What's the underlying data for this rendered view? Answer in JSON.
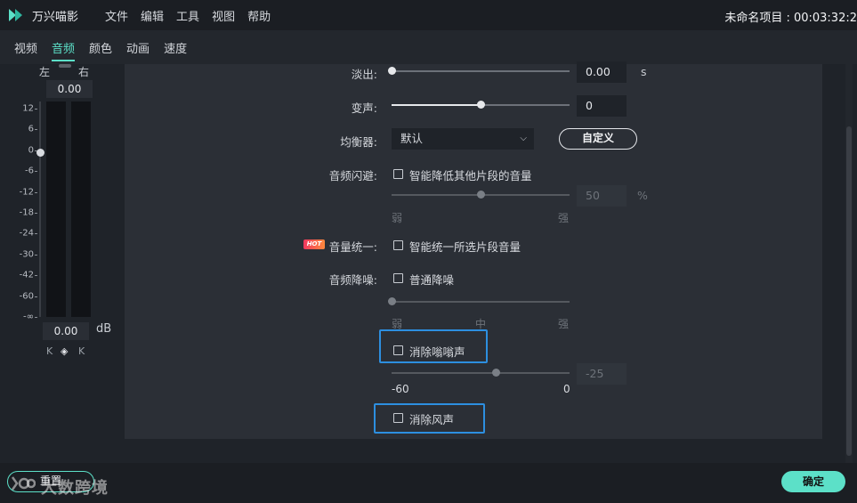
{
  "app": {
    "name": "万兴喵影",
    "project": "未命名项目 : 00:03:32:2"
  },
  "menu": [
    "文件",
    "编辑",
    "工具",
    "视图",
    "帮助"
  ],
  "tabs": [
    "视频",
    "音频",
    "颜色",
    "动画",
    "速度"
  ],
  "active_tab": 1,
  "meter": {
    "left": "左",
    "right": "右",
    "balance": "0.00",
    "ticks": [
      "12",
      "6",
      "0",
      "-6",
      "-12",
      "-18",
      "-24",
      "-30",
      "-42",
      "-60",
      "-∞"
    ],
    "output": "0.00",
    "unit": "dB",
    "keyframe_prev": "K",
    "keyframe_add": "◈",
    "keyframe_next": "K"
  },
  "settings": {
    "fade_out": {
      "label": "淡出:",
      "value": "0.00",
      "unit": "s",
      "level": 0.0
    },
    "voice_change": {
      "label": "变声:",
      "value": "0",
      "level": 0.5
    },
    "equalizer": {
      "label": "均衡器:",
      "selected": "默认",
      "custom_label": "自定义"
    },
    "ducking": {
      "label": "音频闪避:",
      "checkbox": "智能降低其他片段的音量",
      "value": "50",
      "unit": "%",
      "low": "弱",
      "high": "强",
      "level": 0.5
    },
    "normalize": {
      "label": "音量统一:",
      "badge": "HOT",
      "checkbox": "智能统一所选片段音量"
    },
    "denoise": {
      "label": "音频降噪:",
      "checkbox": "普通降噪",
      "low": "弱",
      "mid": "中",
      "high": "强",
      "level": 0.0
    },
    "hum": {
      "checkbox": "消除嗡嗡声",
      "value": "-25",
      "min": "-60",
      "max": "0",
      "level": 0.5833
    },
    "wind": {
      "checkbox": "消除风声"
    }
  },
  "footer": {
    "reset_label": "重置",
    "ok_label": "确定",
    "watermark": "大数跨境"
  }
}
